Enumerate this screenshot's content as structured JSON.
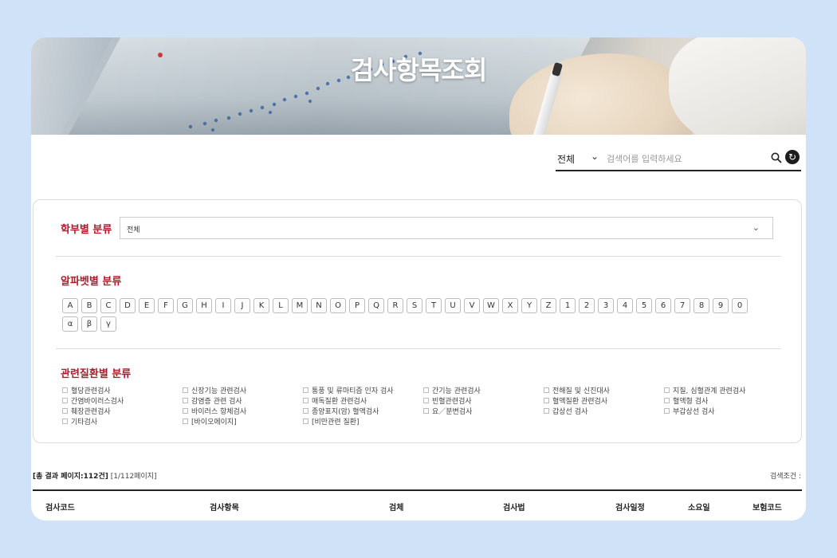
{
  "banner": {
    "title": "검사항목조회"
  },
  "search": {
    "scope_selected": "전체",
    "placeholder": "검색어를 입력하세요"
  },
  "dept_filter": {
    "title": "학부별 분류",
    "selected": "전체"
  },
  "alpha_filter": {
    "title": "알파벳별 분류",
    "letters": [
      "A",
      "B",
      "C",
      "D",
      "E",
      "F",
      "G",
      "H",
      "I",
      "J",
      "K",
      "L",
      "M",
      "N",
      "O",
      "P",
      "Q",
      "R",
      "S",
      "T",
      "U",
      "V",
      "W",
      "X",
      "Y",
      "Z",
      "1",
      "2",
      "3",
      "4",
      "5",
      "6",
      "7",
      "8",
      "9",
      "0",
      "α",
      "β",
      "γ"
    ]
  },
  "disease_filter": {
    "title": "관련질환별 분류",
    "columns": [
      [
        "혈당관련검사",
        "간염바이러스검사",
        "췌장관련검사",
        "기타검사"
      ],
      [
        "신장기능 관련검사",
        "감염증 관련 검사",
        "바이러스 항체검사",
        "[바이오에이지]"
      ],
      [
        "통풍 및 류마티즘 인자 검사",
        "매독질환 관련검사",
        "종양표지(암) 혈액검사",
        "[비만관련 질환]"
      ],
      [
        "간기능 관련검사",
        "빈혈관련검사",
        "요／분변검사"
      ],
      [
        "전해질 및 신진대사",
        "혈액질환 관련검사",
        "갑상선 검사"
      ],
      [
        "지질, 심혈관계 관련검사",
        "혈액형 검사",
        "부갑상선 검사"
      ]
    ]
  },
  "results": {
    "summary": "[총 결과 페이지:112건]",
    "page_info": "[1/112페이지]",
    "condition_label": "검색조건 :",
    "columns": [
      "검사코드",
      "검사항목",
      "검체",
      "검사법",
      "검사일정",
      "소요일",
      "보험코드"
    ]
  }
}
